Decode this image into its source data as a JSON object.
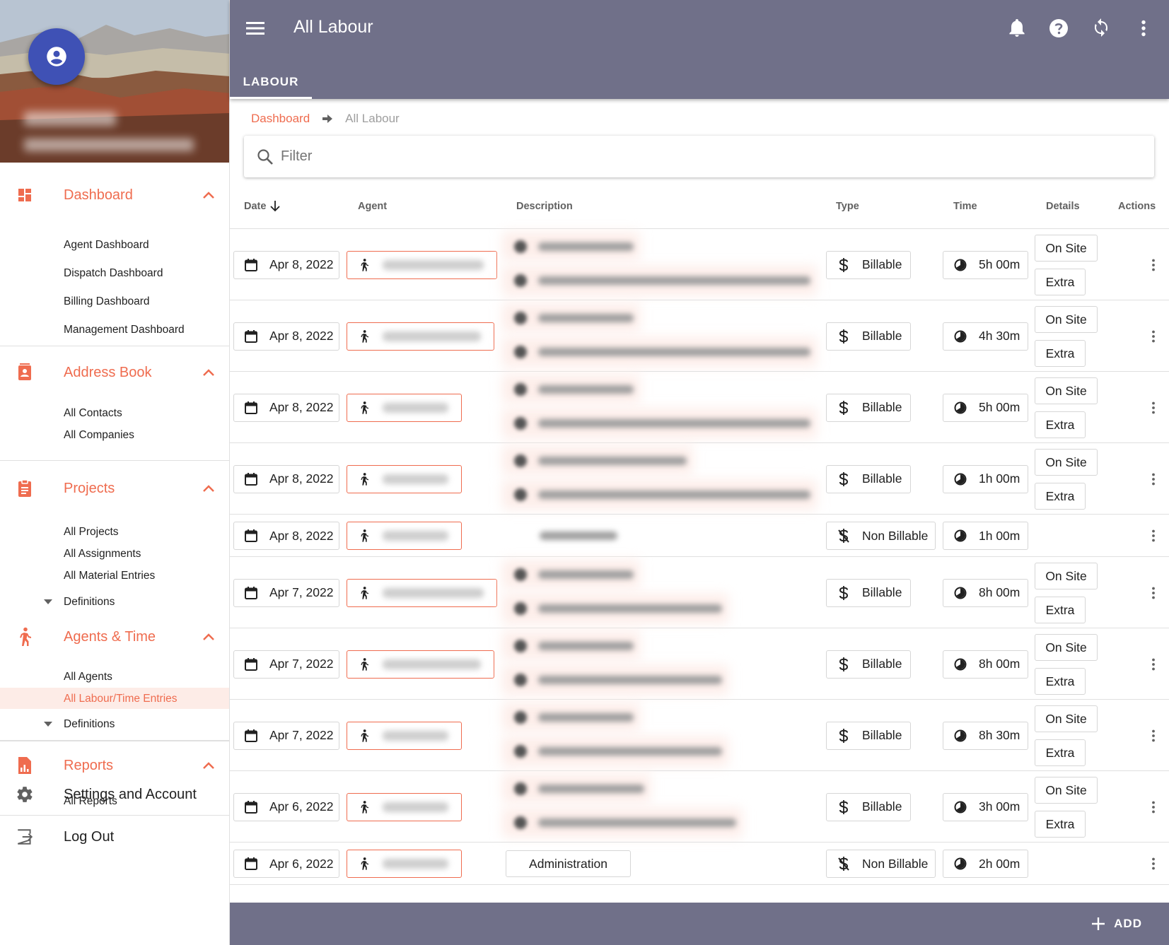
{
  "header": {
    "title": "All Labour",
    "tab": "LABOUR",
    "icons": [
      "menu-icon",
      "bell-icon",
      "help-icon",
      "sync-icon",
      "more-vert-icon"
    ]
  },
  "sidebar": {
    "sections": [
      {
        "label": "Dashboard",
        "icon": "dashboard-icon",
        "items": [
          "Agent Dashboard",
          "Dispatch Dashboard",
          "Billing Dashboard",
          "Management Dashboard"
        ]
      },
      {
        "label": "Address Book",
        "icon": "contacts-icon",
        "items": [
          "All Contacts",
          "All Companies"
        ]
      },
      {
        "label": "Projects",
        "icon": "clipboard-icon",
        "items": [
          "All Projects",
          "All Assignments",
          "All Material Entries",
          "Definitions"
        ]
      },
      {
        "label": "Agents & Time",
        "icon": "walking-person-icon",
        "items": [
          "All Agents",
          "All Labour/Time Entries",
          "Definitions"
        ]
      },
      {
        "label": "Reports",
        "icon": "report-icon",
        "items": [
          "All Reports"
        ]
      }
    ],
    "settings": "Settings and Account",
    "logout": "Log Out"
  },
  "breadcrumb": {
    "home": "Dashboard",
    "current": "All Labour"
  },
  "filter": {
    "placeholder": "Filter"
  },
  "table": {
    "columns": [
      "Date",
      "Agent",
      "Description",
      "Type",
      "Time",
      "Details",
      "Actions"
    ],
    "rows": [
      {
        "date": "Apr 8, 2022",
        "type": "Billable",
        "time": "5h 00m",
        "details": [
          "On Site",
          "Extra"
        ]
      },
      {
        "date": "Apr 8, 2022",
        "type": "Billable",
        "time": "4h 30m",
        "details": [
          "On Site",
          "Extra"
        ]
      },
      {
        "date": "Apr 8, 2022",
        "type": "Billable",
        "time": "5h 00m",
        "details": [
          "On Site",
          "Extra"
        ]
      },
      {
        "date": "Apr 8, 2022",
        "type": "Billable",
        "time": "1h 00m",
        "details": [
          "On Site",
          "Extra"
        ]
      },
      {
        "date": "Apr 8, 2022",
        "type": "Non Billable",
        "time": "1h 00m",
        "details": []
      },
      {
        "date": "Apr 7, 2022",
        "type": "Billable",
        "time": "8h 00m",
        "details": [
          "On Site",
          "Extra"
        ]
      },
      {
        "date": "Apr 7, 2022",
        "type": "Billable",
        "time": "8h 00m",
        "details": [
          "On Site",
          "Extra"
        ]
      },
      {
        "date": "Apr 7, 2022",
        "type": "Billable",
        "time": "8h 30m",
        "details": [
          "On Site",
          "Extra"
        ]
      },
      {
        "date": "Apr 6, 2022",
        "type": "Billable",
        "time": "3h 00m",
        "details": [
          "On Site",
          "Extra"
        ]
      },
      {
        "date": "Apr 6, 2022",
        "type": "Non Billable",
        "time": "2h 00m",
        "details": [],
        "description": "Administration"
      }
    ]
  },
  "add_button": "ADD",
  "colors": {
    "accent": "#ef6c4f",
    "appbar": "#707089",
    "avatar": "#3f51b5"
  }
}
